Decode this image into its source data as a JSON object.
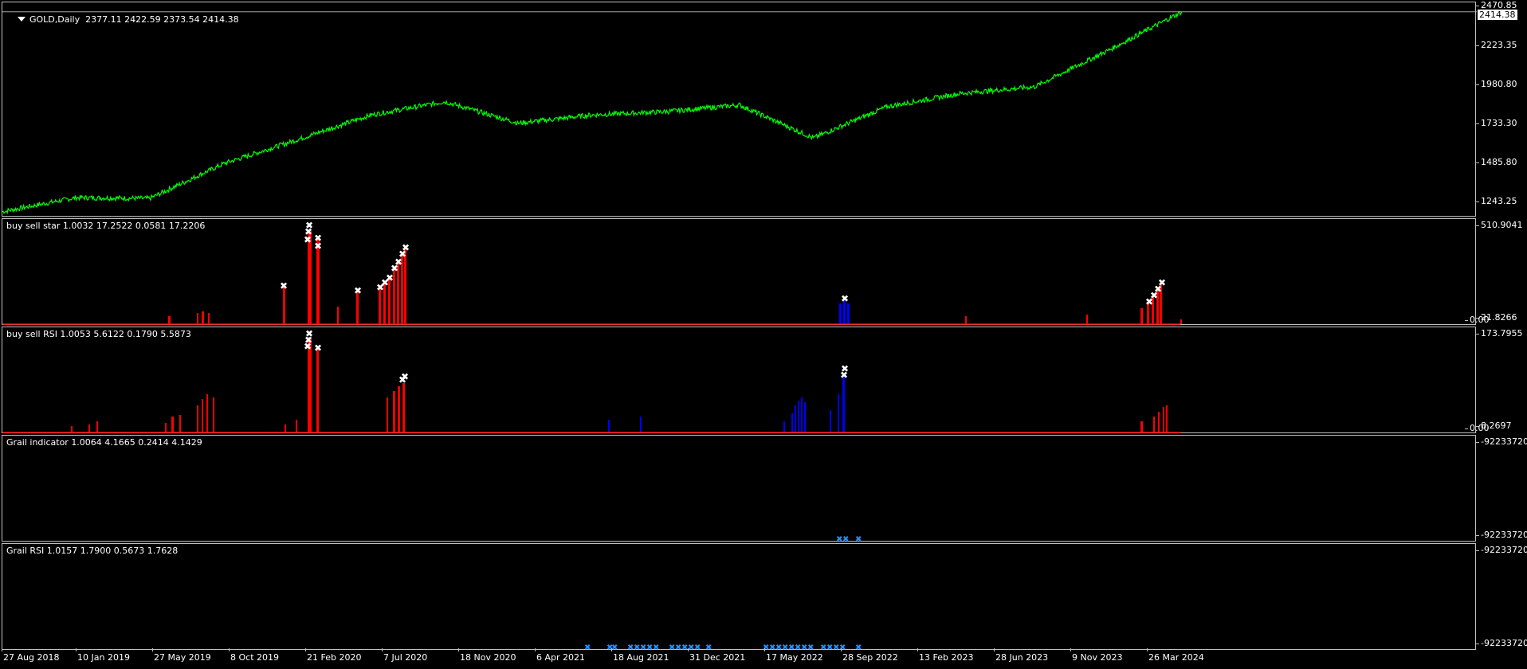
{
  "main": {
    "symbol": "GOLD,Daily",
    "ohlc": "2377.11 2422.59 2373.54 2414.38",
    "current_price": "2414.38",
    "scale": [
      "2470.85",
      "2223.35",
      "1980.80",
      "1733.30",
      "1485.80",
      "1243.25"
    ]
  },
  "indicators": [
    {
      "title": "buy sell star 1.0032 17.2522 0.0581 17.2206",
      "scale": [
        "510.9041",
        "21.8266",
        "0.00"
      ]
    },
    {
      "title": "buy sell RSI 1.0053 5.6122 0.1790 5.5873",
      "scale": [
        "173.7955",
        "8.2697",
        "0.00"
      ]
    },
    {
      "title": "Grail indicator 1.0064 4.1665 0.2414 4.1429",
      "scale": [
        "-92233720",
        "-92233720"
      ]
    },
    {
      "title": "Grail RSI 1.0157 1.7900 0.5673 1.7628",
      "scale": [
        "-92233720",
        "-92233720"
      ]
    }
  ],
  "x_axis": [
    "27 Aug 2018",
    "10 Jan 2019",
    "27 May 2019",
    "8 Oct 2019",
    "21 Feb 2020",
    "7 Jul 2020",
    "18 Nov 2020",
    "6 Apr 2021",
    "18 Aug 2021",
    "31 Dec 2021",
    "17 May 2022",
    "28 Sep 2022",
    "13 Feb 2023",
    "28 Jun 2023",
    "9 Nov 2023",
    "26 Mar 2024"
  ],
  "colors": {
    "price_line": "#00ff00",
    "sell_hist": "#ff0000",
    "buy_hist": "#0000ff",
    "marker": "#ffffff",
    "grail_marker": "#1e90ff"
  },
  "chart_data": [
    {
      "type": "line",
      "title": "GOLD,Daily",
      "x": [
        "27 Aug 2018",
        "10 Jan 2019",
        "27 May 2019",
        "8 Oct 2019",
        "21 Feb 2020",
        "7 Jul 2020",
        "18 Nov 2020",
        "6 Apr 2021",
        "18 Aug 2021",
        "31 Dec 2021",
        "17 May 2022",
        "28 Sep 2022",
        "13 Feb 2023",
        "28 Jun 2023",
        "9 Nov 2023",
        "26 Mar 2024",
        "2 May 2024"
      ],
      "series": [
        {
          "name": "GOLD,Daily",
          "values": [
            1205,
            1290,
            1285,
            1495,
            1640,
            1790,
            1870,
            1740,
            1790,
            1810,
            1850,
            1650,
            1840,
            1920,
            1960,
            2180,
            2414
          ]
        }
      ],
      "ylim": [
        1170,
        2470.85
      ]
    }
  ]
}
